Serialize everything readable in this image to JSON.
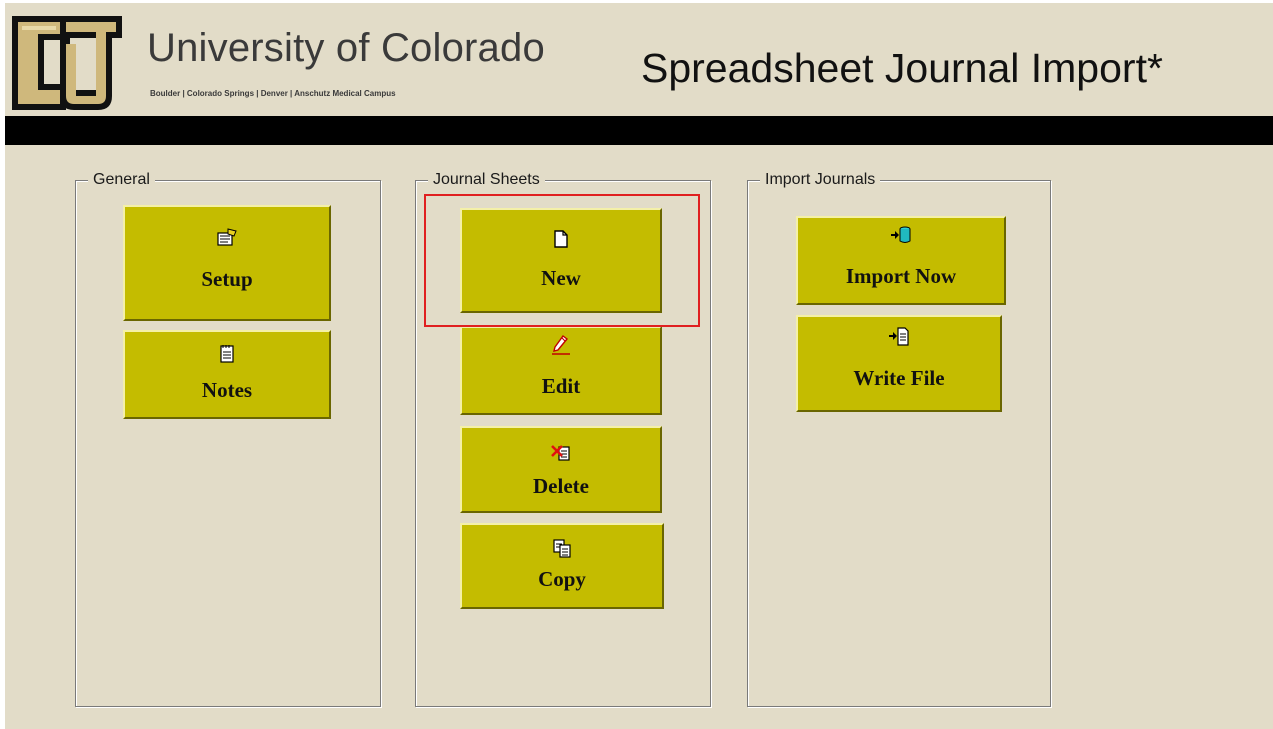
{
  "header": {
    "org_name": "University of Colorado",
    "campuses": "Boulder | Colorado Springs | Denver | Anschutz Medical Campus",
    "app_title": "Spreadsheet Journal Import*"
  },
  "groups": {
    "general": {
      "legend": "General",
      "buttons": [
        {
          "label": "Setup",
          "icon": "setup-form-icon"
        },
        {
          "label": "Notes",
          "icon": "notepad-icon"
        }
      ]
    },
    "journal_sheets": {
      "legend": "Journal Sheets",
      "buttons": [
        {
          "label": "New",
          "icon": "new-document-icon"
        },
        {
          "label": "Edit",
          "icon": "pencil-icon"
        },
        {
          "label": "Delete",
          "icon": "delete-x-icon"
        },
        {
          "label": "Copy",
          "icon": "copy-documents-icon"
        }
      ]
    },
    "import_journals": {
      "legend": "Import Journals",
      "buttons": [
        {
          "label": "Import Now",
          "icon": "import-database-icon"
        },
        {
          "label": "Write File",
          "icon": "write-file-icon"
        }
      ]
    }
  },
  "colors": {
    "window_bg": "#e2dcc8",
    "button_bg": "#c4bc00",
    "highlight": "#e02020",
    "logo_gold": "#cfb87c"
  }
}
